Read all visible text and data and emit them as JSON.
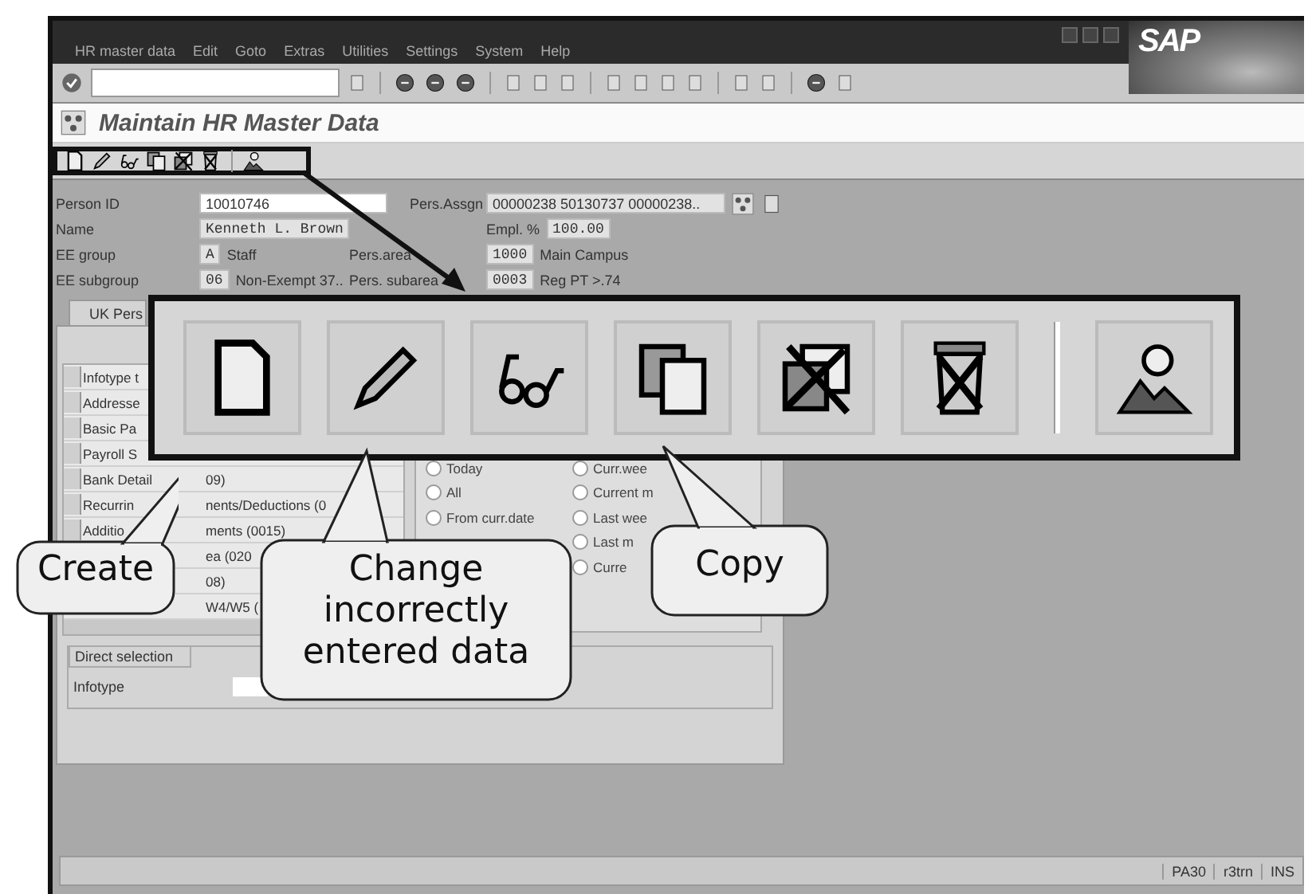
{
  "menu": [
    "HR master data",
    "Edit",
    "Goto",
    "Extras",
    "Utilities",
    "Settings",
    "System",
    "Help"
  ],
  "logo": "SAP",
  "title": "Maintain HR Master Data",
  "header": {
    "person_id_label": "Person ID",
    "person_id": "10010746",
    "pers_assgn_label": "Pers.Assgn",
    "pers_assgn": "00000238 50130737 00000238..",
    "name_label": "Name",
    "name": "Kenneth L. Brown",
    "empl_label": "Empl. %",
    "empl": "100.00",
    "ee_group_label": "EE group",
    "ee_group_code": "A",
    "ee_group": "Staff",
    "pers_area_label": "Pers.area",
    "pers_area_code": "1000",
    "pers_area": "Main Campus",
    "ee_subgroup_label": "EE subgroup",
    "ee_subgroup_code": "06",
    "ee_subgroup": "Non-Exempt 37..",
    "pers_subarea_label": "Pers. subarea",
    "pers_subarea_code": "0003",
    "pers_subarea": "Reg PT >.74"
  },
  "tab": "UK Pers",
  "infotypes": [
    {
      "text": "Infotype t"
    },
    {
      "text": "Addresse"
    },
    {
      "text": "Basic Pa"
    },
    {
      "text": "Payroll S"
    },
    {
      "text": "Bank Detail",
      "after": "09)"
    },
    {
      "text": "Recurrin",
      "after": "nents/Deductions (0"
    },
    {
      "text": "Additio",
      "after": "ments (0015)"
    },
    {
      "after": "ea (020"
    },
    {
      "after": "08)"
    },
    {
      "after": "W4/W5 ("
    }
  ],
  "periods_left": [
    {
      "label": "Today",
      "selected": false
    },
    {
      "label": "All",
      "selected": false
    },
    {
      "label": "From curr.date",
      "selected": false
    }
  ],
  "periods_right": [
    {
      "label": "Curr.wee",
      "selected": false
    },
    {
      "label": "Current m",
      "selected": false
    },
    {
      "label": "Last wee",
      "selected": false
    },
    {
      "label": "Last m",
      "selected": false
    },
    {
      "label": "Curre",
      "selected": false
    }
  ],
  "direct_selection": {
    "title": "Direct selection",
    "label": "Infotype"
  },
  "status_bar": {
    "transaction": "PA30",
    "server": "r3trn",
    "mode": "INS"
  },
  "callouts": [
    {
      "text": "Create"
    },
    {
      "text": "Change incorrectly entered data"
    },
    {
      "text": "Copy"
    }
  ]
}
